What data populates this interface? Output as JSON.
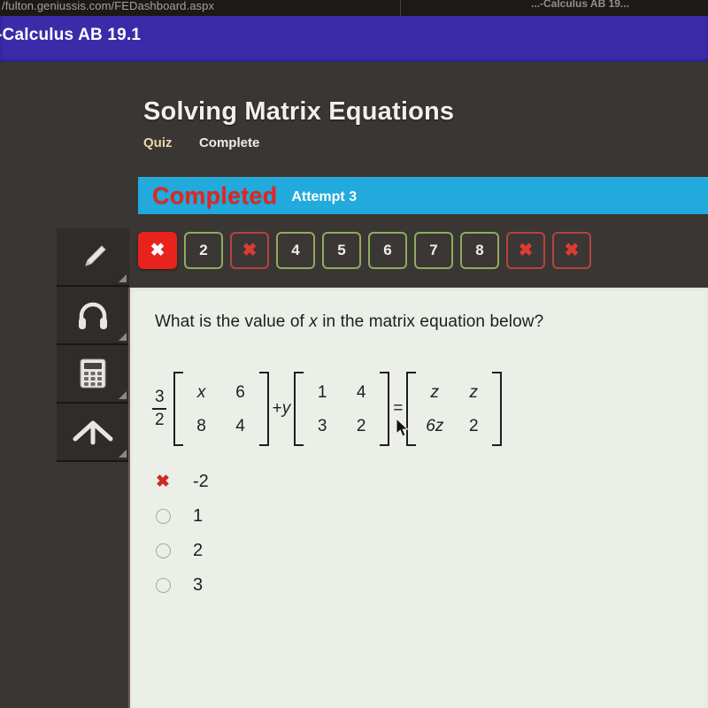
{
  "browser": {
    "url": "/fulton.geniussis.com/FEDashboard.aspx",
    "tab_title": "...-Calculus AB 19..."
  },
  "course_band": {
    "title": "-Calculus AB 19.1",
    "color": "#3b2ba8"
  },
  "quiz": {
    "title": "Solving Matrix Equations",
    "kind": "Quiz",
    "state": "Complete",
    "kind_color": "#e8d7a8"
  },
  "status_banner": {
    "status": "Completed",
    "attempt": "Attempt 3",
    "background": "#21aadb",
    "status_color": "#e8231e"
  },
  "question_nav": {
    "items": [
      {
        "label": "✖",
        "state": "current-wrong"
      },
      {
        "label": "2",
        "state": "correct"
      },
      {
        "label": "✖",
        "state": "wrong"
      },
      {
        "label": "4",
        "state": "correct"
      },
      {
        "label": "5",
        "state": "correct"
      },
      {
        "label": "6",
        "state": "correct"
      },
      {
        "label": "7",
        "state": "correct"
      },
      {
        "label": "8",
        "state": "correct"
      },
      {
        "label": "✖",
        "state": "wrong"
      },
      {
        "label": "✖",
        "state": "wrong"
      }
    ],
    "correct_color": "#8fab5e",
    "wrong_color": "#b5443f",
    "current_color": "#e8231e"
  },
  "tools": [
    {
      "name": "highlighter-tool"
    },
    {
      "name": "audio-tool"
    },
    {
      "name": "calculator-tool"
    },
    {
      "name": "collapse-tool"
    }
  ],
  "question": {
    "prompt_before": "What is the value of ",
    "prompt_variable": "x",
    "prompt_after": " in the matrix equation below?",
    "equation": {
      "scalar_numerator": "3",
      "scalar_denominator": "2",
      "matrix_a": [
        "x",
        "6",
        "8",
        "4"
      ],
      "operator_plus": "+",
      "scalar_y": "y",
      "matrix_b": [
        "1",
        "4",
        "3",
        "2"
      ],
      "operator_equals": "=",
      "matrix_c": [
        "z",
        "z",
        "6z",
        "2"
      ]
    },
    "choices": [
      {
        "label": "-2",
        "mark": "x"
      },
      {
        "label": "1",
        "mark": "radio"
      },
      {
        "label": "2",
        "mark": "radio"
      },
      {
        "label": "3",
        "mark": "radio"
      }
    ]
  }
}
